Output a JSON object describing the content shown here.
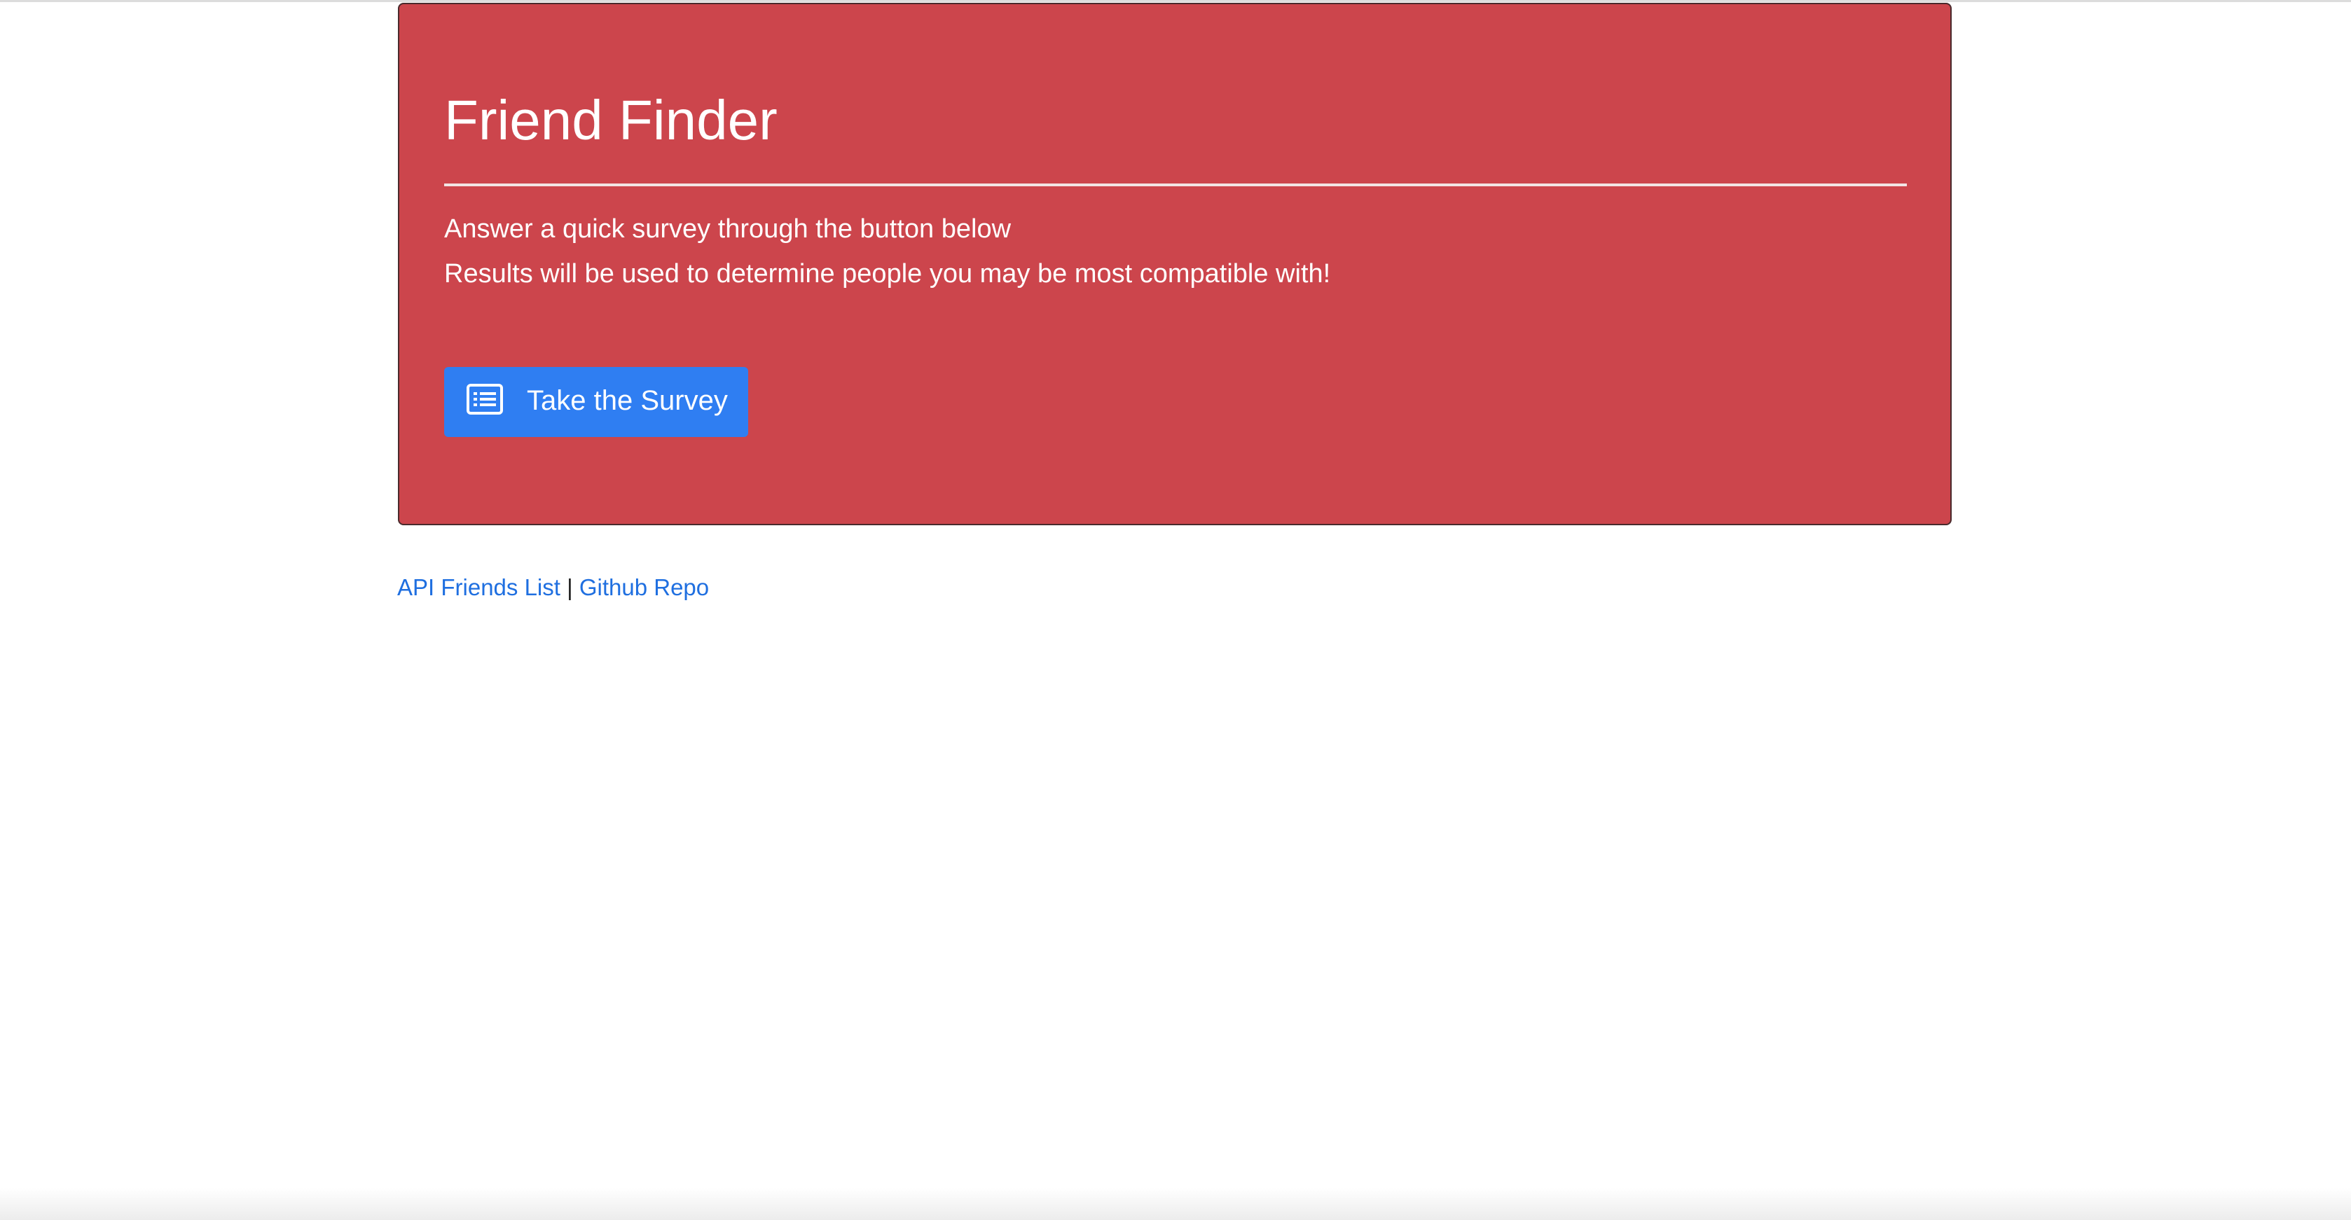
{
  "hero": {
    "title": "Friend Finder",
    "lead_line_1": "Answer a quick survey through the button below",
    "lead_line_2": "Results will be used to determine people you may be most compatible with!",
    "background_color": "#cc454c"
  },
  "survey_button": {
    "label": "Take the Survey",
    "icon": "list-icon",
    "color": "#2f7ef2"
  },
  "footer": {
    "links": [
      {
        "label": "API Friends List"
      },
      {
        "label": "Github Repo"
      }
    ],
    "separator": "|",
    "link_color": "#1f6fe0"
  }
}
